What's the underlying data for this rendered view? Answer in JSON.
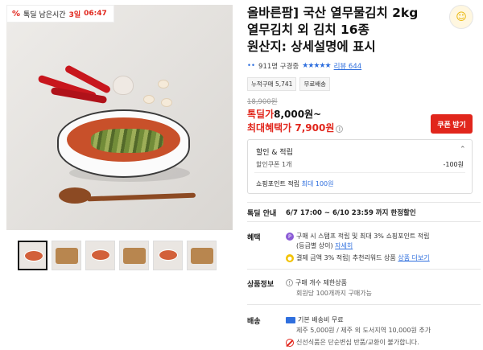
{
  "badge": {
    "label": "톡딜 남은시간",
    "days": "3일",
    "time": "06:47"
  },
  "product": {
    "title_lines": [
      "올바른팜] 국산 열무물김치 2kg",
      "열무김치 외 김치 16종",
      "원산지: 상세설명에 표시"
    ]
  },
  "social": {
    "viewers": "911명 구경중",
    "stars": "★★★★★",
    "review": "리뷰 644"
  },
  "tags": [
    "누적구매 5,741",
    "무료배송"
  ],
  "price": {
    "original": "18,900원",
    "deal_label": "톡딜가",
    "deal_amount": "8,000원~",
    "max_label": "최대혜택가",
    "max_amount": "7,900원",
    "coupon_button": "쿠폰 받기"
  },
  "benefit_box": {
    "title": "할인 & 적립",
    "coupon_label": "할인쿠폰 1개",
    "coupon_value": "-100원",
    "point_label": "쇼핑포인트 적립",
    "point_value": "최대 100원"
  },
  "deal_info": {
    "label": "톡딜 안내",
    "text": "6/7 17:00 ~ 6/10 23:59 까지 한정할인"
  },
  "benefits": {
    "label": "혜택",
    "line1a": "구매 시 스탬프 적립 및 최대 3% 쇼핑포인트 적립",
    "line1b": "(등급별 상이)",
    "line1_link": "자세히",
    "line2": "결제 금액 3% 적립| 추천리워드 상품",
    "line2_link": "상품 더보기"
  },
  "product_info": {
    "label": "상품정보",
    "line1": "구매 개수 제한상품",
    "line2": "회원당 100개까지 구매가능"
  },
  "shipping": {
    "label": "배송",
    "line1": "기본 배송비 무료",
    "line2": "제주 5,000원 / 제주 외 도서지역 10,000원 추가",
    "line3": "신선식품은 단순변심 반품/교환이 불가합니다."
  },
  "thumbnails": [
    "thumb-1",
    "thumb-2",
    "thumb-3",
    "thumb-4",
    "thumb-5",
    "thumb-6"
  ],
  "colors": {
    "accent_red": "#e1261c",
    "link_blue": "#2f6fde"
  }
}
